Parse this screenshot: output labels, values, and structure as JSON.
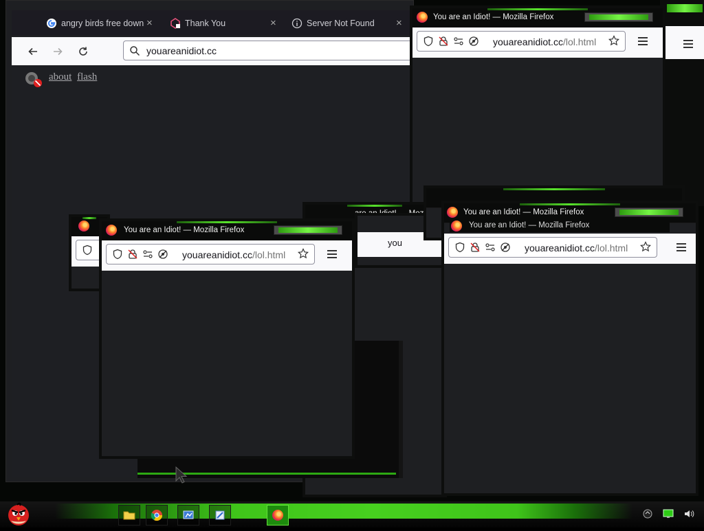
{
  "main_browser": {
    "tabs": [
      {
        "label": "angry birds free downl",
        "icon": "google-icon"
      },
      {
        "label": "Thank You",
        "icon": "warning-site-icon"
      },
      {
        "label": "Server Not Found",
        "icon": "info-icon"
      }
    ],
    "tab_close": "×",
    "url": "youareanidiot.cc",
    "content": {
      "link_about": "about",
      "link_flash": "flash"
    }
  },
  "popup": {
    "title": "You are an Idiot! — Mozilla Firefox",
    "url_host": "youareanidiot.cc",
    "url_path": "/lol.html"
  },
  "partial_text": {
    "you": "you",
    "yous": "youa",
    "iot": "idiot.cc/lol.html",
    "rs": "ar"
  },
  "popup_partial_title": "are an Idiot! — Mozilla Firefox",
  "taskbar": {
    "icons": [
      "folder-icon",
      "chrome-icon",
      "control-panel-icon",
      "app-icon",
      "firefox-icon"
    ],
    "tray": [
      "network-icon",
      "monitor-icon",
      "volume-icon"
    ],
    "accent": "#47d01f"
  }
}
